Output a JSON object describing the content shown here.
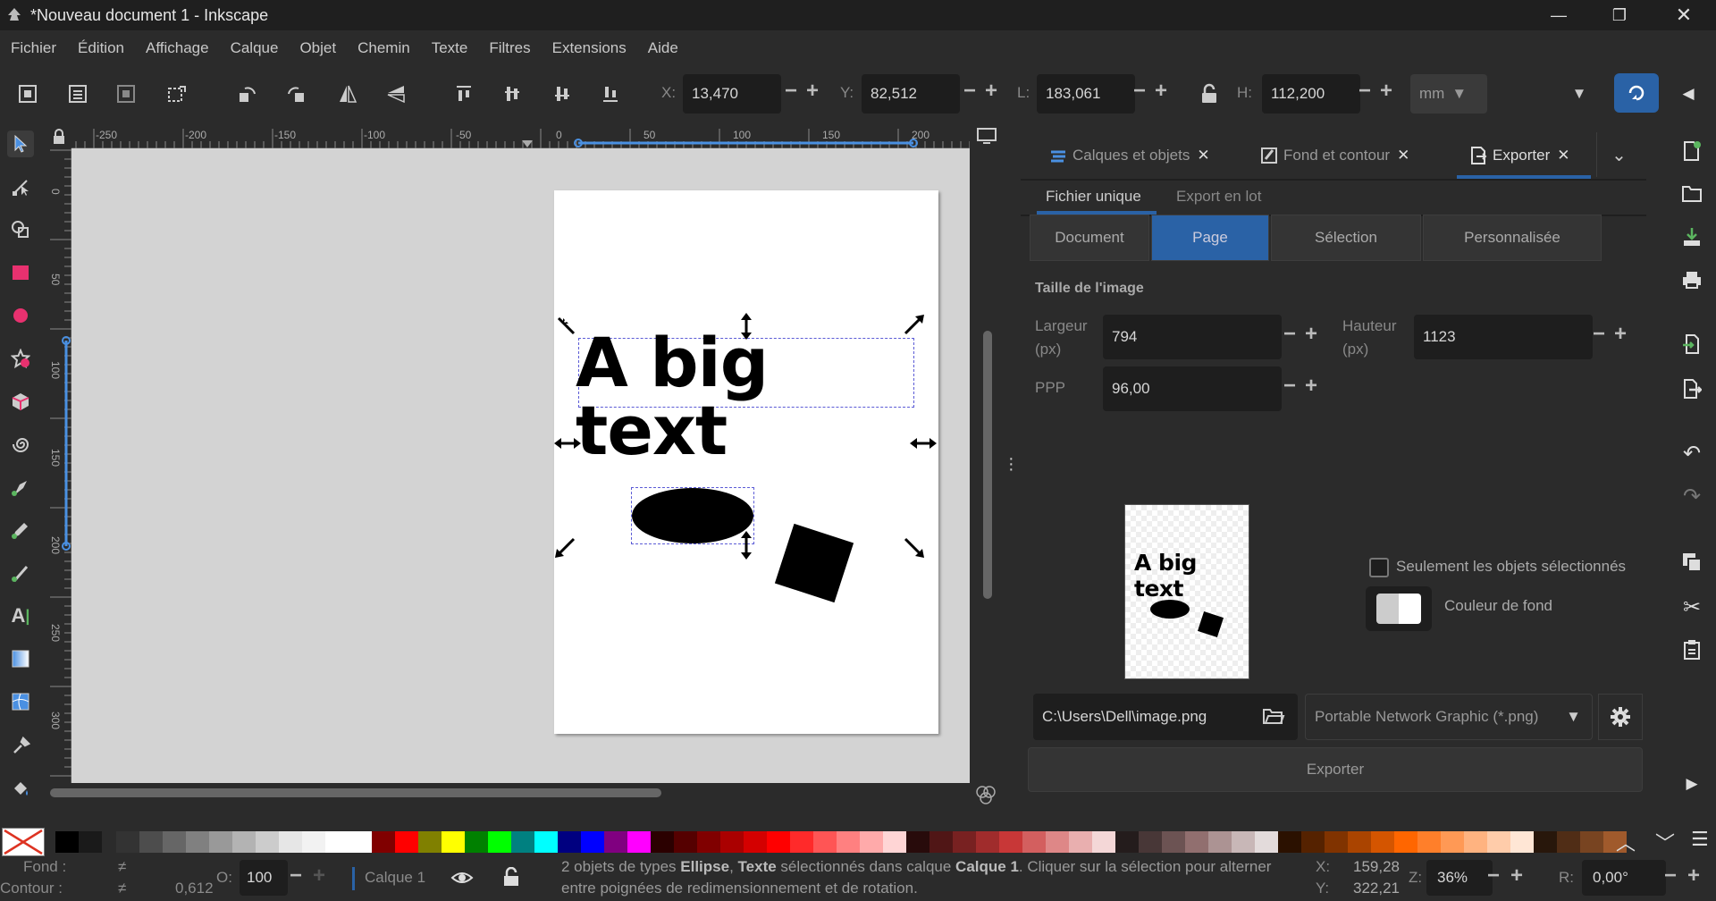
{
  "window": {
    "title": "*Nouveau document 1 - Inkscape"
  },
  "menu": [
    "Fichier",
    "Édition",
    "Affichage",
    "Calque",
    "Objet",
    "Chemin",
    "Texte",
    "Filtres",
    "Extensions",
    "Aide"
  ],
  "toolbar": {
    "x_label": "X:",
    "x_value": "13,470",
    "y_label": "Y:",
    "y_value": "82,512",
    "w_label": "L:",
    "w_value": "183,061",
    "h_label": "H:",
    "h_value": "112,200",
    "unit": "mm"
  },
  "ruler": {
    "h_ticks": [
      "-250",
      "-200",
      "-150",
      "-100",
      "-50",
      "0",
      "50",
      "100",
      "150",
      "200"
    ],
    "v_ticks": [
      "0",
      "50",
      "100",
      "150",
      "200",
      "250",
      "300"
    ]
  },
  "canvas": {
    "text": "A big text"
  },
  "panel": {
    "tabs": [
      "Calques et objets",
      "Fond et contour",
      "Exporter"
    ],
    "subtabs": [
      "Fichier unique",
      "Export en lot"
    ],
    "area_buttons": [
      "Document",
      "Page",
      "Sélection",
      "Personnalisée"
    ],
    "section_title": "Taille de l'image",
    "width_label": "Largeur\n(px)",
    "width_value": "794",
    "height_label": "Hauteur\n(px)",
    "height_value": "1123",
    "dpi_label": "PPP",
    "dpi_value": "96,00",
    "preview_text": "A big text",
    "only_selected_label": "Seulement les objets sélectionnés",
    "bg_color_label": "Couleur de fond",
    "path_value": "C:\\Users\\Dell\\image.png",
    "format_value": "Portable Network Graphic (*.png)",
    "export_button": "Exporter"
  },
  "status": {
    "fill_label": "Fond :",
    "fill_value": "≠",
    "stroke_label": "Contour :",
    "stroke_value": "≠",
    "stroke_width": "0,612",
    "opacity_label": "O:",
    "opacity_value": "100",
    "layer": "Calque 1",
    "message_line1_a": "2 objets de types ",
    "message_line1_b": "Ellipse",
    "message_line1_c": ", ",
    "message_line1_d": "Texte",
    "message_line1_e": " sélectionnés dans calque ",
    "message_line1_f": "Calque 1",
    "message_line1_g": ". Cliquer sur la sélection pour alterner",
    "message_line2": "entre poignées de redimensionnement et de rotation.",
    "cx_label": "X:",
    "cx_value": "159,28",
    "cy_label": "Y:",
    "cy_value": "322,21",
    "zoom_label": "Z:",
    "zoom_value": "36%",
    "rot_label": "R:",
    "rot_value": "0,00°"
  },
  "colors": {
    "accent": "#2a62a6",
    "panel_bg": "#2b2b2b",
    "canvas_bg": "#d3d3d3"
  }
}
